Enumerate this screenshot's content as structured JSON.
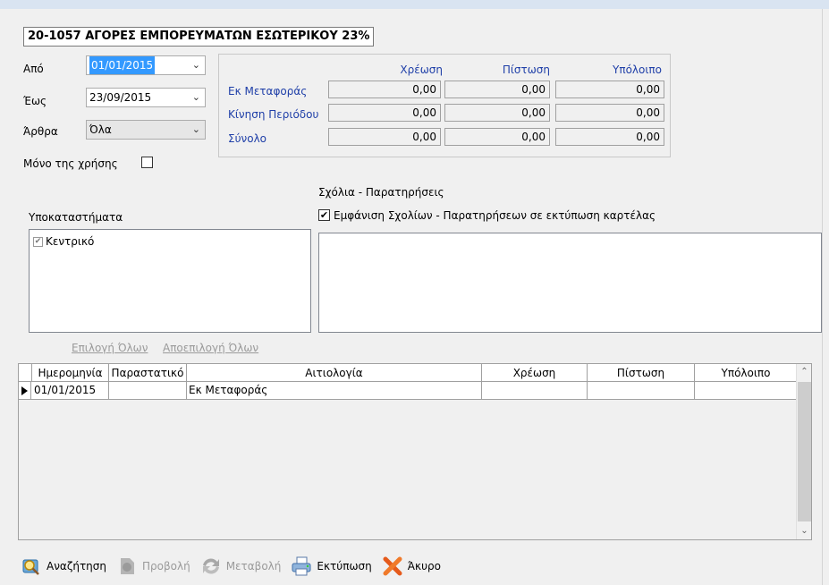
{
  "title": "20-1057 ΑΓΟΡΕΣ ΕΜΠΟΡΕΥΜΑΤΩΝ ΕΣΩΤΕΡΙΚΟΥ 23%",
  "filters": {
    "from_label": "Από",
    "from_value": "01/01/2015",
    "to_label": "Έως",
    "to_value": "23/09/2015",
    "articles_label": "Άρθρα",
    "articles_value": "Όλα",
    "only_year_label": "Μόνο της χρήσης",
    "only_year_checked": false
  },
  "totals": {
    "headers": [
      "Χρέωση",
      "Πίστωση",
      "Υπόλοιπο"
    ],
    "rows": [
      {
        "label": "Εκ Μεταφοράς",
        "values": [
          "0,00",
          "0,00",
          "0,00"
        ]
      },
      {
        "label": "Κίνηση Περιόδου",
        "values": [
          "0,00",
          "0,00",
          "0,00"
        ]
      },
      {
        "label": "Σύνολο",
        "values": [
          "0,00",
          "0,00",
          "0,00"
        ]
      }
    ]
  },
  "branches": {
    "label": "Υποκαταστήματα",
    "items": [
      {
        "label": "Κεντρικό",
        "checked": true
      }
    ],
    "select_all": "Επιλογή Όλων",
    "deselect_all": "Αποεπιλογή Όλων"
  },
  "comments": {
    "label": "Σχόλια - Παρατηρήσεις",
    "show_label": "Εμφάνιση Σχολίων - Παρατηρήσεων σε εκτύπωση καρτέλας",
    "show_checked": true,
    "text": ""
  },
  "grid": {
    "columns": [
      "Ημερομηνία",
      "Παραστατικό",
      "Αιτιολογία",
      "Χρέωση",
      "Πίστωση",
      "Υπόλοιπο"
    ],
    "rows": [
      {
        "date": "01/01/2015",
        "doc": "",
        "reason": "Εκ Μεταφοράς",
        "debit": "",
        "credit": "",
        "balance": ""
      }
    ]
  },
  "toolbar": {
    "search": "Αναζήτηση",
    "view": "Προβολή",
    "edit": "Μεταβολή",
    "print": "Εκτύπωση",
    "cancel": "Άκυρο"
  },
  "colors": {
    "accent_blue": "#1f3fa8",
    "selection": "#3399ff",
    "background": "#f0f0f0"
  }
}
